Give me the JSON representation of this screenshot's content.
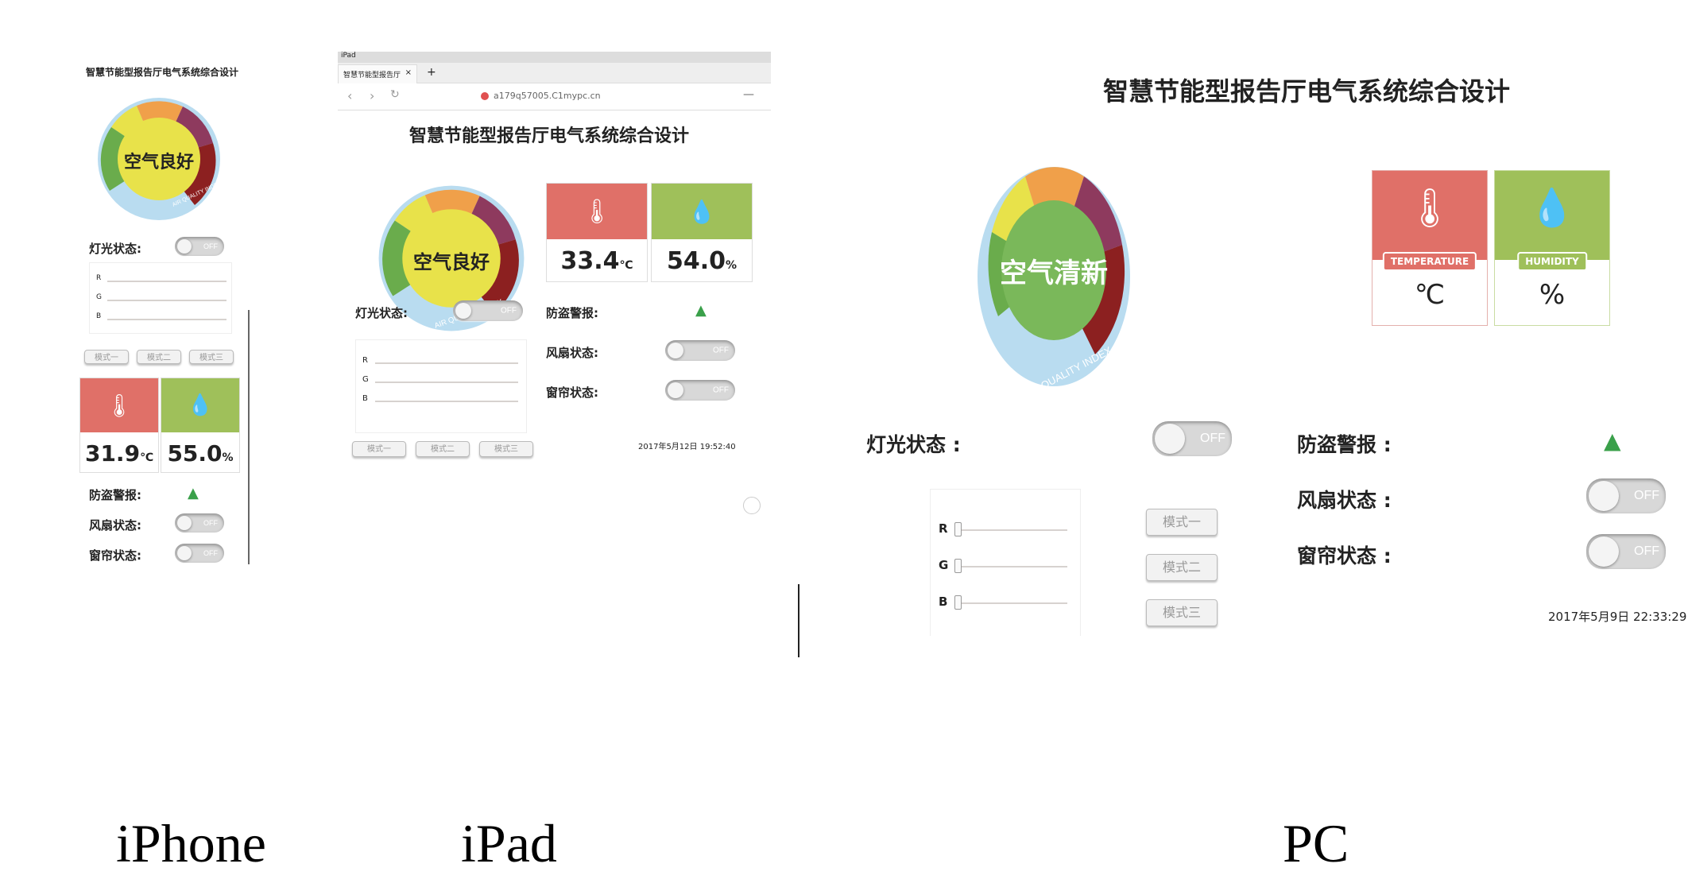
{
  "captions": {
    "iphone": "iPhone",
    "ipad": "iPad",
    "pc": "PC"
  },
  "colors": {
    "red": "#e07068",
    "green": "#9fc05a",
    "gauge_yellow": "#e8e24a",
    "gauge_orange": "#f0a04a",
    "gauge_purple": "#8e3a5e",
    "gauge_darkred": "#8c2020",
    "gauge_green": "#6aac4c",
    "ring_blue": "#b9dcf0"
  },
  "iphone": {
    "title": "智慧节能型报告厅电气系统综合设计",
    "air_status": "空气良好",
    "air_index": "AIR QUALITY INDEX",
    "light_label": "灯光状态:",
    "off": "OFF",
    "rgb": [
      "R",
      "G",
      "B"
    ],
    "modes": [
      "模式一",
      "模式二",
      "模式三"
    ],
    "temperature": "31.9",
    "temp_unit": "℃",
    "humidity": "55.0",
    "hum_unit": "%",
    "alarm_label": "防盗警报:",
    "fan_label": "风扇状态:",
    "curtain_label": "窗帘状态:"
  },
  "ipad": {
    "status_bar": "iPad",
    "tab_title": "智慧节能型报告厅",
    "url": "a179q57005.C1mypc.cn",
    "title": "智慧节能型报告厅电气系统综合设计",
    "air_status": "空气良好",
    "air_index": "AIR QUALITY INDEX",
    "temperature": "33.4",
    "temp_unit": "℃",
    "humidity": "54.0",
    "hum_unit": "%",
    "light_label": "灯光状态:",
    "alarm_label": "防盗警报:",
    "fan_label": "风扇状态:",
    "curtain_label": "窗帘状态:",
    "off": "OFF",
    "rgb": [
      "R",
      "G",
      "B"
    ],
    "modes": [
      "模式一",
      "模式二",
      "模式三"
    ],
    "datetime": "2017年5月12日 19:52:40"
  },
  "pc": {
    "title": "智慧节能型报告厅电气系统综合设计",
    "air_status": "空气清新",
    "air_index": "AIR QUALITY INDEX",
    "temp_tag": "TEMPERATURE",
    "hum_tag": "HUMIDITY",
    "temp_unit": "℃",
    "hum_unit": "%",
    "light_label": "灯光状态 :",
    "alarm_label": "防盗警报 :",
    "fan_label": "风扇状态 :",
    "curtain_label": "窗帘状态 :",
    "off": "OFF",
    "rgb": [
      "R",
      "G",
      "B"
    ],
    "modes": [
      "模式一",
      "模式二",
      "模式三"
    ],
    "datetime": "2017年5月9日 22:33:29"
  }
}
